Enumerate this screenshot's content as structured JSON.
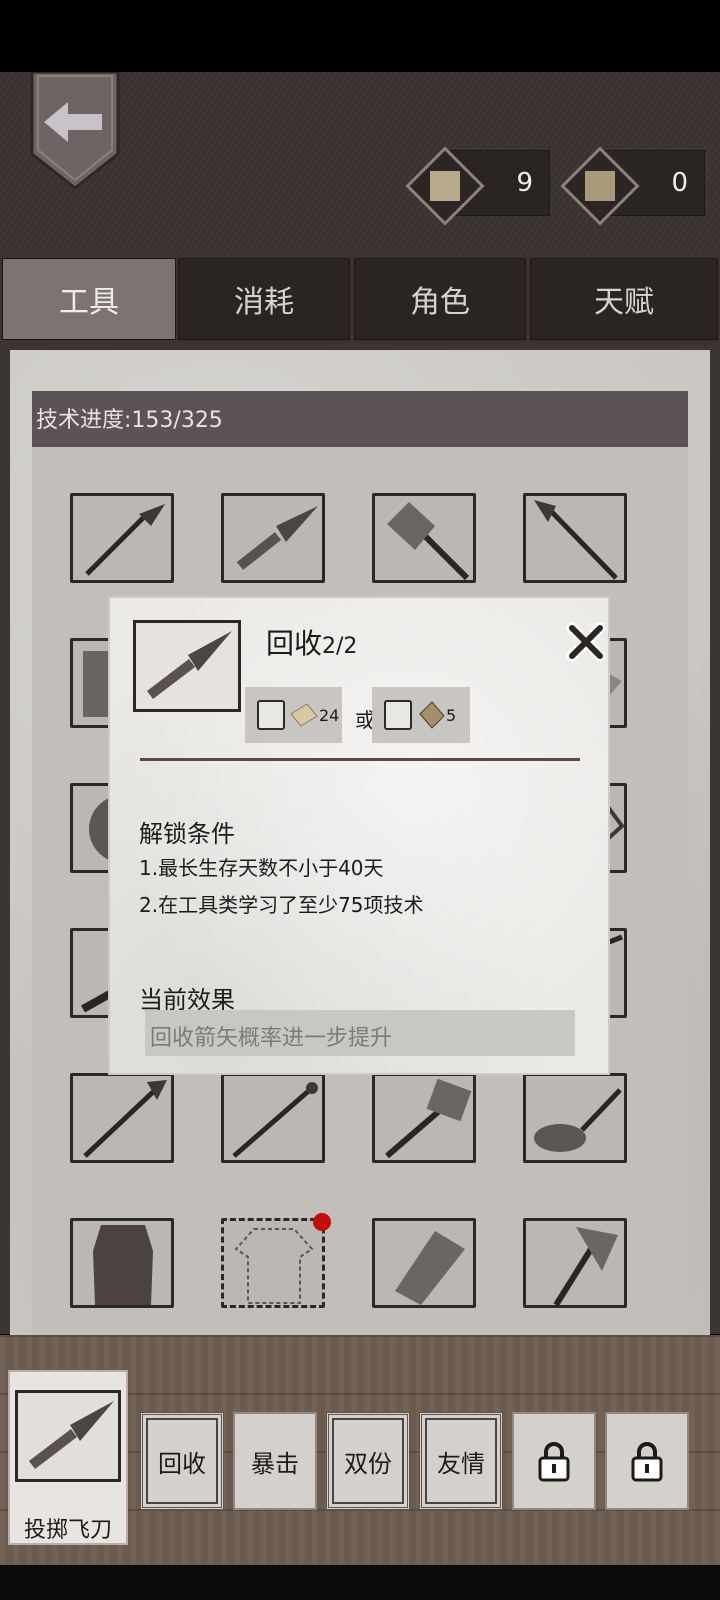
{
  "header": {
    "back_icon": "back-arrow-icon",
    "resources": [
      {
        "icon": "parchment-scroll-icon",
        "value": "9"
      },
      {
        "icon": "spellbook-icon",
        "value": "0"
      }
    ]
  },
  "tabs": [
    {
      "label": "工具",
      "active": true
    },
    {
      "label": "消耗",
      "active": false
    },
    {
      "label": "角色",
      "active": false
    },
    {
      "label": "天赋",
      "active": false
    }
  ],
  "progress": {
    "label": "技术进度:153/325"
  },
  "grid": {
    "items": [
      "spear-icon",
      "throwing-knife-icon",
      "stone-hammer-icon",
      "iron-spear-icon",
      "armor-icon",
      "",
      "",
      "axe-icon",
      "shield-icon",
      "",
      "",
      "bow-icon",
      "club-icon",
      "",
      "",
      "pick-icon",
      "long-spear-icon",
      "staff-icon",
      "big-hammer-icon",
      "frying-pan-icon",
      "leather-vest-icon",
      "empty-shirt-slot-icon",
      "stone-club-icon",
      "battle-axe-icon"
    ]
  },
  "popup": {
    "title": "回收",
    "level": "2/2",
    "cost_a": {
      "icon": "parchment-scroll-icon",
      "amount": "24"
    },
    "or_label": "或",
    "cost_b": {
      "icon": "spellbook-icon",
      "amount": "5"
    },
    "unlock_title": "解锁条件",
    "conditions": [
      "1.最长生存天数不小于40天",
      "2.在工具类学习了至少75项技术"
    ],
    "effect_title": "当前效果",
    "effect_text": "回收箭矢概率进一步提升"
  },
  "selected": {
    "label": "投掷飞刀"
  },
  "perks": [
    "回收",
    "暴击",
    "双份",
    "友情",
    "",
    ""
  ]
}
